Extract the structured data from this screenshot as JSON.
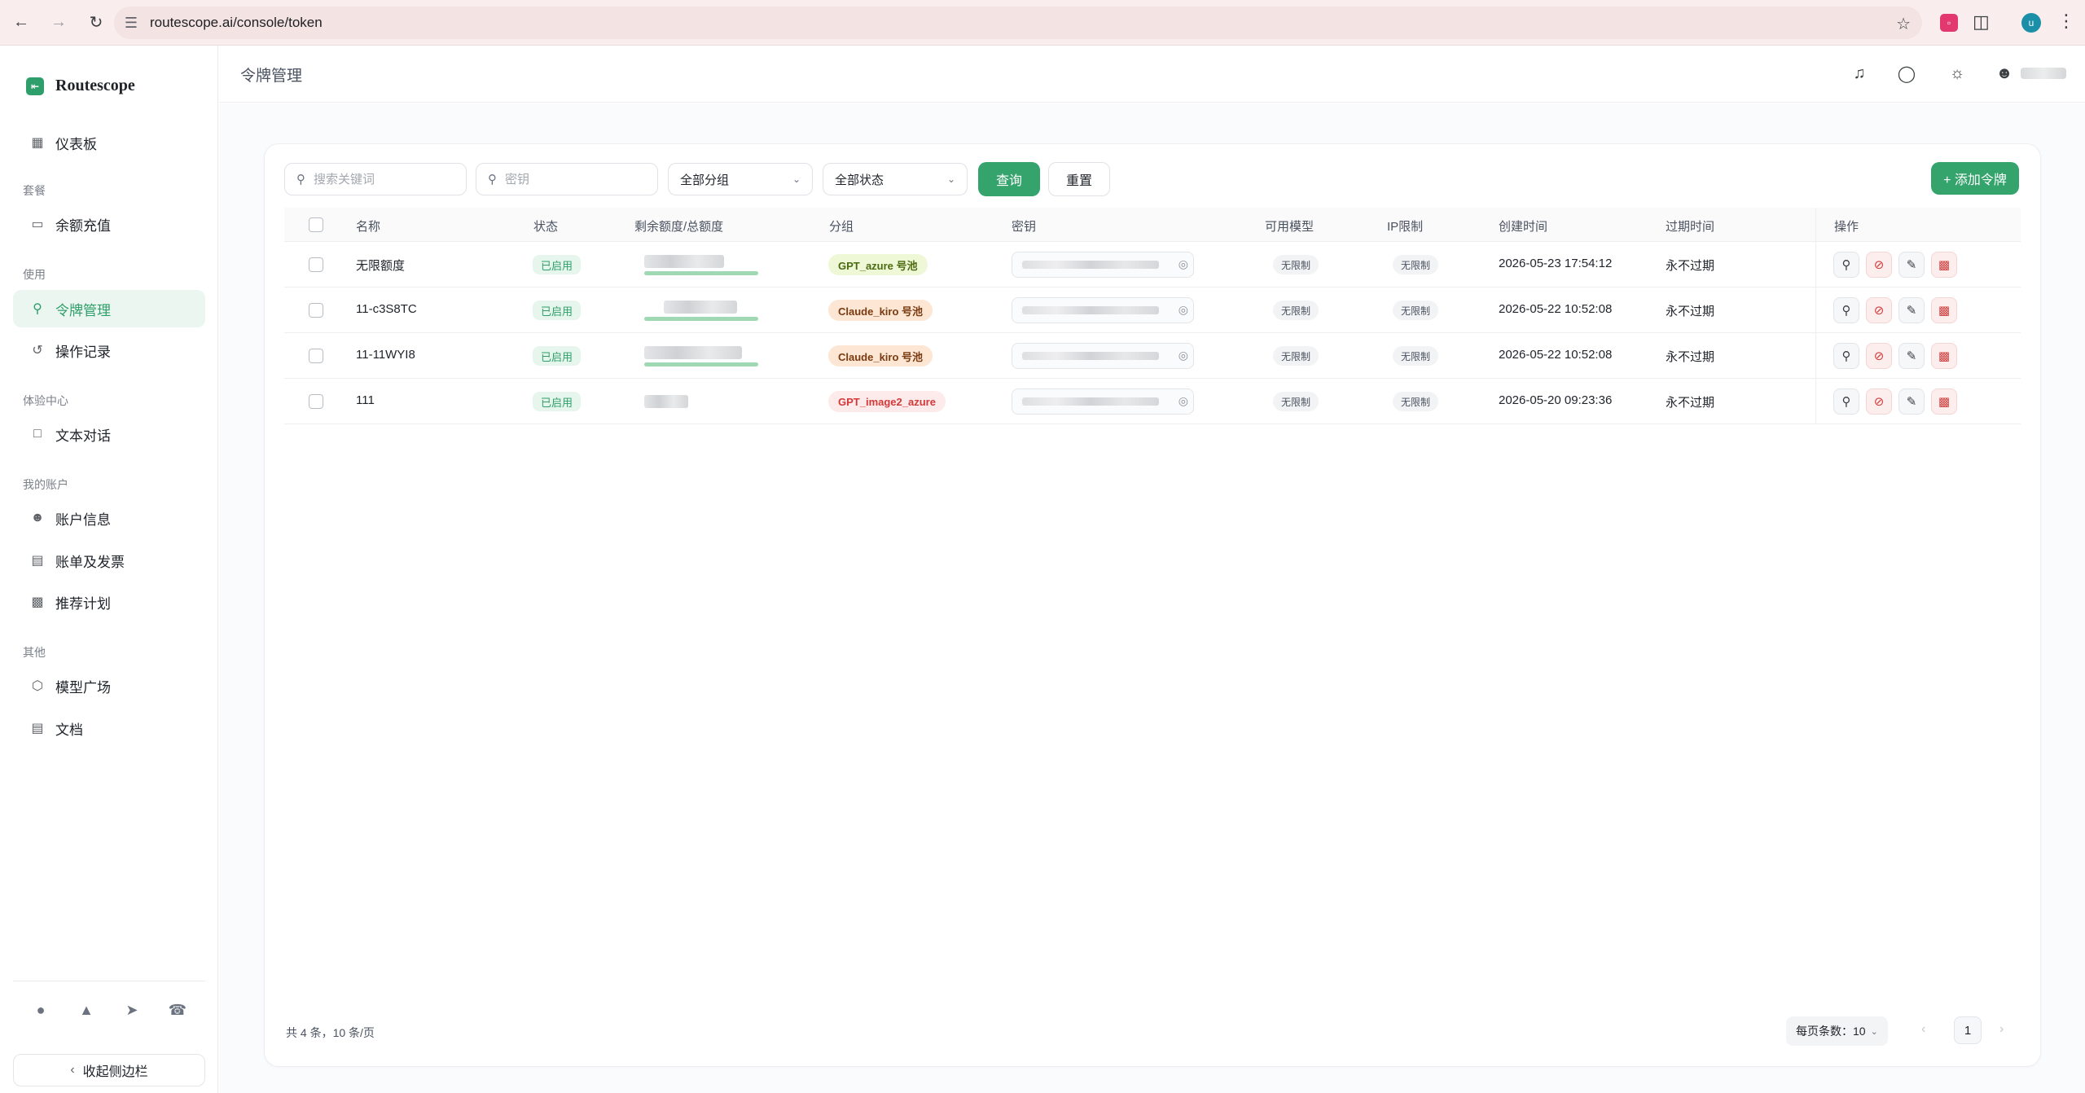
{
  "browser": {
    "url": "routescope.ai/console/token",
    "profile_initial": "u"
  },
  "sidebar": {
    "brand": "Routescope",
    "dashboard": "仪表板",
    "sec_plan": "套餐",
    "recharge": "余额充值",
    "sec_use": "使用",
    "tokens": "令牌管理",
    "logs": "操作记录",
    "sec_exp": "体验中心",
    "chat": "文本对话",
    "sec_account": "我的账户",
    "account_info": "账户信息",
    "billing": "账单及发票",
    "referral": "推荐计划",
    "sec_other": "其他",
    "models": "模型广场",
    "docs": "文档",
    "collapse": "收起侧边栏"
  },
  "header": {
    "title": "令牌管理"
  },
  "toolbar": {
    "search_placeholder": "搜索关键词",
    "key_placeholder": "密钥",
    "group_select": "全部分组",
    "status_select": "全部状态",
    "query": "查询",
    "reset": "重置",
    "add": "+ 添加令牌"
  },
  "table": {
    "headers": {
      "name": "名称",
      "status": "状态",
      "quota": "剩余额度/总额度",
      "group": "分组",
      "key": "密钥",
      "models": "可用模型",
      "ip": "IP限制",
      "created": "创建时间",
      "expires": "过期时间",
      "actions": "操作"
    },
    "rows": [
      {
        "name": "无限额度",
        "status": "已启用",
        "group": "GPT_azure 号池",
        "models": "无限制",
        "ip": "无限制",
        "created": "2026-05-23 17:54:12",
        "expires": "永不过期"
      },
      {
        "name": "11-c3S8TC",
        "status": "已启用",
        "group": "Claude_kiro 号池",
        "models": "无限制",
        "ip": "无限制",
        "created": "2026-05-22 10:52:08",
        "expires": "永不过期"
      },
      {
        "name": "11-11WYI8",
        "status": "已启用",
        "group": "Claude_kiro 号池",
        "models": "无限制",
        "ip": "无限制",
        "created": "2026-05-22 10:52:08",
        "expires": "永不过期"
      },
      {
        "name": "111",
        "status": "已启用",
        "group": "GPT_image2_azure",
        "models": "无限制",
        "ip": "无限制",
        "created": "2026-05-20 09:23:36",
        "expires": "永不过期"
      }
    ]
  },
  "footer": {
    "total": "共 4 条，10 条/页",
    "page_size": "每页条数：10",
    "current_page": "1"
  }
}
